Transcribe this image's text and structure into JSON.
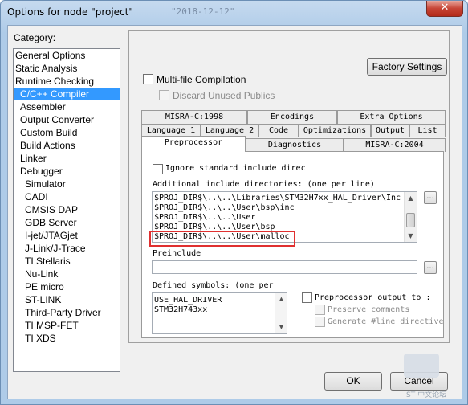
{
  "window": {
    "title": "Options for node \"project\"",
    "title_ghost": "\"2018-12-12\"",
    "close_glyph": "✕"
  },
  "category": {
    "label": "Category:",
    "items": [
      {
        "label": "General Options",
        "level": 0,
        "selected": false
      },
      {
        "label": "Static Analysis",
        "level": 0,
        "selected": false
      },
      {
        "label": "Runtime Checking",
        "level": 0,
        "selected": false
      },
      {
        "label": "C/C++ Compiler",
        "level": 1,
        "selected": true
      },
      {
        "label": "Assembler",
        "level": 1,
        "selected": false
      },
      {
        "label": "Output Converter",
        "level": 1,
        "selected": false
      },
      {
        "label": "Custom Build",
        "level": 1,
        "selected": false
      },
      {
        "label": "Build Actions",
        "level": 1,
        "selected": false
      },
      {
        "label": "Linker",
        "level": 1,
        "selected": false
      },
      {
        "label": "Debugger",
        "level": 1,
        "selected": false
      },
      {
        "label": "Simulator",
        "level": 2,
        "selected": false
      },
      {
        "label": "CADI",
        "level": 2,
        "selected": false
      },
      {
        "label": "CMSIS DAP",
        "level": 2,
        "selected": false
      },
      {
        "label": "GDB Server",
        "level": 2,
        "selected": false
      },
      {
        "label": "I-jet/JTAGjet",
        "level": 2,
        "selected": false
      },
      {
        "label": "J-Link/J-Trace",
        "level": 2,
        "selected": false
      },
      {
        "label": "TI Stellaris",
        "level": 2,
        "selected": false
      },
      {
        "label": "Nu-Link",
        "level": 2,
        "selected": false
      },
      {
        "label": "PE micro",
        "level": 2,
        "selected": false
      },
      {
        "label": "ST-LINK",
        "level": 2,
        "selected": false
      },
      {
        "label": "Third-Party Driver",
        "level": 2,
        "selected": false
      },
      {
        "label": "TI MSP-FET",
        "level": 2,
        "selected": false
      },
      {
        "label": "TI XDS",
        "level": 2,
        "selected": false
      }
    ]
  },
  "panel": {
    "factory_settings": "Factory Settings",
    "multi_file": "Multi-file Compilation",
    "discard_unused": "Discard Unused Publics"
  },
  "tabs": {
    "row1": [
      "MISRA-C:1998",
      "Encodings",
      "Extra Options"
    ],
    "row2": [
      "Language 1",
      "Language 2",
      "Code",
      "Optimizations",
      "Output",
      "List"
    ],
    "row3": [
      "Preprocessor",
      "Diagnostics",
      "MISRA-C:2004"
    ],
    "active": "Preprocessor"
  },
  "preprocessor": {
    "ignore_std": "Ignore standard include direc",
    "include_label": "Additional include directories: (one per line)",
    "include_lines": [
      "$PROJ_DIR$\\..\\..\\Libraries\\STM32H7xx_HAL_Driver\\Inc",
      "$PROJ_DIR$\\..\\..\\User\\bsp\\inc",
      "$PROJ_DIR$\\..\\..\\User",
      "$PROJ_DIR$\\..\\..\\User\\bsp",
      "$PROJ_DIR$\\..\\..\\User\\malloc"
    ],
    "browse_glyph": "...",
    "preinclude_label": "Preinclude",
    "preinclude_value": "",
    "defined_label": "Defined symbols: (one per",
    "defined_lines": [
      "USE_HAL_DRIVER",
      "STM32H743xx"
    ],
    "pp_output": "Preprocessor output to :",
    "preserve_comments": "Preserve comments",
    "generate_line": "Generate #line directive"
  },
  "footer": {
    "ok": "OK",
    "cancel": "Cancel"
  },
  "watermark": {
    "text": "ST 中文论坛"
  }
}
